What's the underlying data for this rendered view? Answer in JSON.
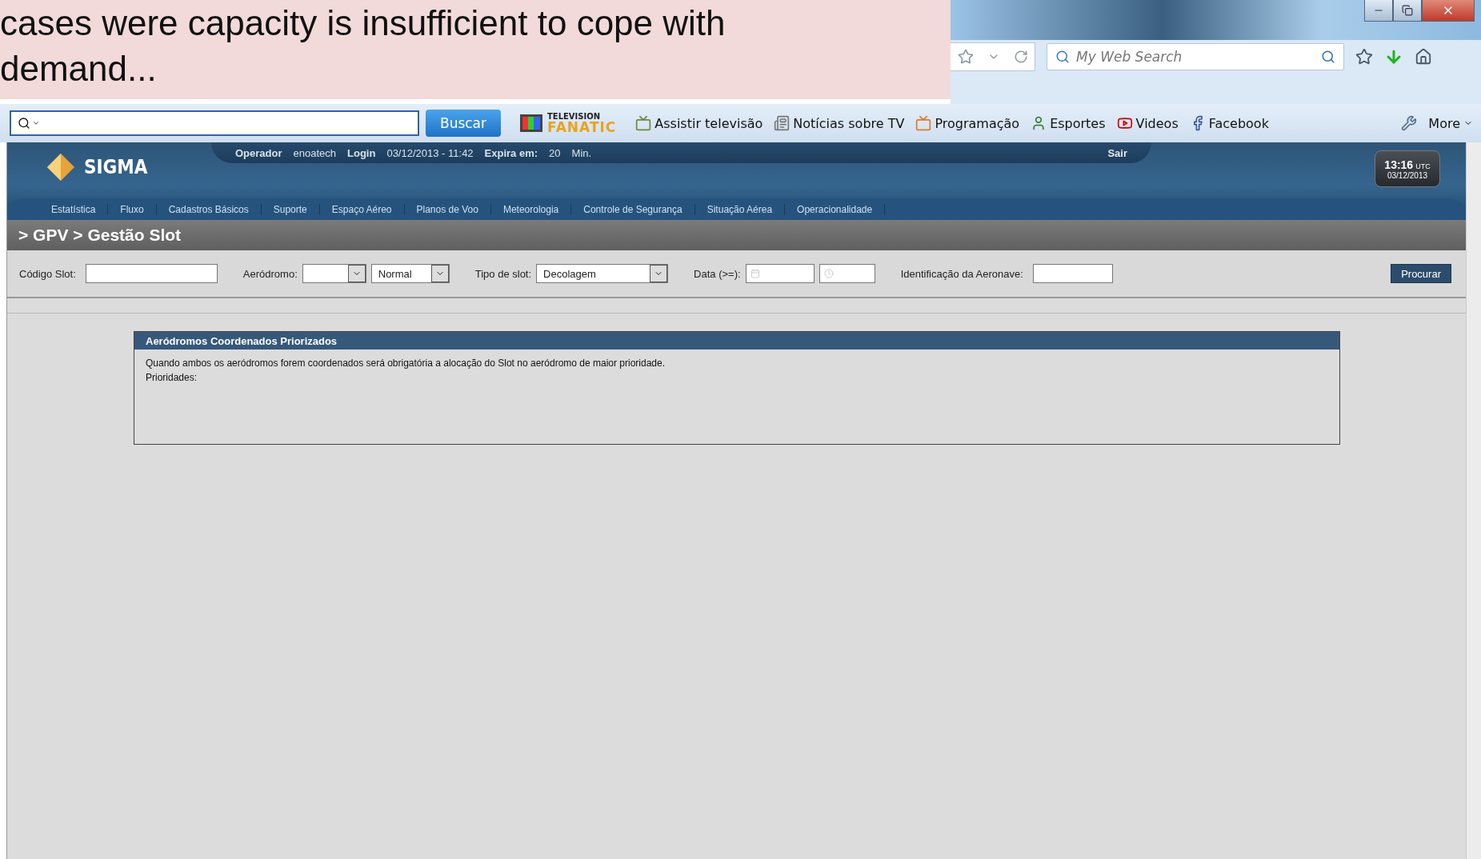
{
  "slide_text": "cases were capacity is insufficient to cope with demand...",
  "browser": {
    "search_placeholder": "My Web Search"
  },
  "toolbar": {
    "search_button": "Buscar",
    "logo_top": "TELEVISION",
    "logo_bottom": "FANATIC",
    "links": [
      {
        "label": "Assistir televisão"
      },
      {
        "label": "Notícias sobre TV"
      },
      {
        "label": "Programação"
      },
      {
        "label": "Esportes"
      },
      {
        "label": "Videos"
      },
      {
        "label": "Facebook"
      }
    ],
    "more": "More"
  },
  "header": {
    "logo": "SIGMA",
    "session": [
      {
        "text": "Operador",
        "bold": true
      },
      {
        "text": "enoatech",
        "bold": false
      },
      {
        "text": "Login",
        "bold": true
      },
      {
        "text": "03/12/2013 - 11:42",
        "bold": false
      },
      {
        "text": "Expira em:",
        "bold": true
      },
      {
        "text": "20",
        "bold": false
      },
      {
        "text": "Min.",
        "bold": false
      }
    ],
    "logout": "Sair",
    "clock": {
      "time": "13:16",
      "zone": "UTC",
      "date": "03/12/2013"
    }
  },
  "menu": [
    "Estatística",
    "Fluxo",
    "Cadastros Básicos",
    "Suporte",
    "Espaço Aéreo",
    "Planos de Voo",
    "Meteorologia",
    "Controle de Segurança",
    "Situação Aérea",
    "Operacionalidade"
  ],
  "breadcrumb": "> GPV > Gestão Slot",
  "filters": [
    {
      "label": "Código Slot:",
      "fields": [
        {
          "kind": "text"
        }
      ]
    },
    {
      "label": "Aeródromo:",
      "fields": [
        {
          "kind": "select"
        },
        {
          "kind": "select",
          "value": "Normal"
        }
      ]
    },
    {
      "label": "Tipo de slot:",
      "fields": [
        {
          "kind": "select",
          "value": "Decolagem"
        }
      ]
    },
    {
      "label": "Data (>=):",
      "fields": [
        {
          "kind": "date"
        },
        {
          "kind": "time"
        }
      ]
    },
    {
      "label": "Identificação da Aeronave:",
      "fields": [
        {
          "kind": "text"
        }
      ]
    }
  ],
  "search_button": "Procurar",
  "panel": {
    "title": "Aeródromos Coordenados Priorizados",
    "lines": [
      "Quando ambos os aeródromos forem coordenados será obrigatória a alocação do Slot no aeródromo de maior prioridade.",
      "Prioridades:"
    ]
  }
}
